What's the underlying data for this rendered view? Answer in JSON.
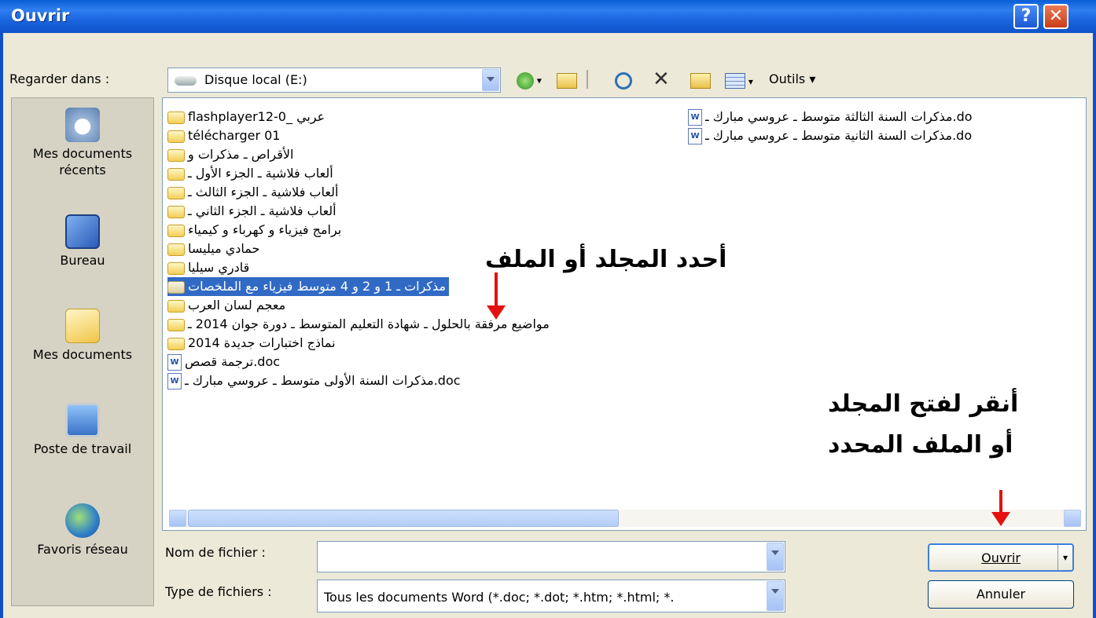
{
  "window": {
    "title": "Ouvrir",
    "help_label": "?",
    "close_label": "✕"
  },
  "lookin": {
    "label": "Regarder dans :",
    "value": "Disque local (E:)"
  },
  "toolbar": {
    "tools_label": "Outils ▾"
  },
  "places": [
    {
      "label": "Mes documents récents",
      "icon": "recent-documents-icon"
    },
    {
      "label": "Bureau",
      "icon": "desktop-icon"
    },
    {
      "label": "Mes documents",
      "icon": "my-documents-icon"
    },
    {
      "label": "Poste de travail",
      "icon": "my-computer-icon"
    },
    {
      "label": "Favoris réseau",
      "icon": "network-places-icon"
    }
  ],
  "files_left": [
    {
      "name": "flashplayer12-0_ عربي",
      "type": "folder"
    },
    {
      "name": "télécharger 01",
      "type": "folder"
    },
    {
      "name": "الأقراص ـ مذكرات و",
      "type": "folder"
    },
    {
      "name": "ألعاب فلاشية ـ الجزء الأول ـ",
      "type": "folder"
    },
    {
      "name": "ألعاب فلاشية ـ الجزء الثالث ـ",
      "type": "folder"
    },
    {
      "name": "ألعاب فلاشية ـ الجزء الثاني ـ",
      "type": "folder"
    },
    {
      "name": "برامج فيزياء و كهرباء و كيمياء",
      "type": "folder"
    },
    {
      "name": "حمادي ميليسا",
      "type": "folder"
    },
    {
      "name": "قادري سيليا",
      "type": "folder"
    },
    {
      "name": "مذكرات ـ 1 و 2 و 4 متوسط فيزياء مع الملخصات",
      "type": "folder",
      "selected": true
    },
    {
      "name": "معجم لسان العرب",
      "type": "folder"
    },
    {
      "name": "مواضيع مرفقة بالحلول ـ شهادة التعليم المتوسط ـ دورة جوان 2014 ـ",
      "type": "folder"
    },
    {
      "name": "نماذج اختبارات جديدة 2014",
      "type": "folder"
    },
    {
      "name": "ترجمة قصص.doc",
      "type": "doc"
    },
    {
      "name": "مذكرات السنة الأولى متوسط ـ عروسي مبارك ـ.doc",
      "type": "doc"
    }
  ],
  "files_right": [
    {
      "name": "مذكرات السنة الثالثة متوسط ـ عروسي مبارك ـ.do",
      "type": "doc"
    },
    {
      "name": "مذكرات السنة الثانية متوسط ـ عروسي مبارك ـ.do",
      "type": "doc"
    }
  ],
  "annotations": {
    "select_hint": "أحدد المجلد أو الملف",
    "open_hint_1": "أنقر لفتح المجلد",
    "open_hint_2": "أو الملف المحدد"
  },
  "filename": {
    "label": "Nom de fichier :",
    "value": ""
  },
  "filetype": {
    "label": "Type de fichiers :",
    "value": "Tous les documents Word (*.doc; *.dot; *.htm; *.html; *."
  },
  "buttons": {
    "open": "Ouvrir",
    "cancel": "Annuler"
  },
  "colors": {
    "titlebar": "#0a5fd6",
    "selection": "#316ac5",
    "arrow": "#e51010",
    "dialog_bg": "#ece9d8"
  }
}
